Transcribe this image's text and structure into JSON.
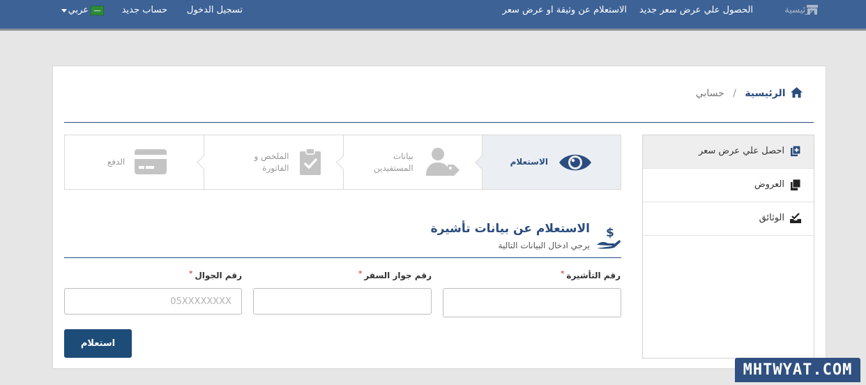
{
  "topbar": {
    "home": "الرئيسية",
    "get_quote": "الحصول علي عرض سعر جديد",
    "inquiry": "الاستعلام عن وثيقة او عرض سعر",
    "login": "تسجيل الدخول",
    "new_account": "حساب جديد",
    "language": "عربي"
  },
  "breadcrumb": {
    "home": "الرئيسية",
    "separator": "/",
    "current": "حسابي"
  },
  "sidebar": {
    "items": [
      {
        "label": "احصل علي عرض سعر",
        "icon": "add-copy-icon",
        "active": true
      },
      {
        "label": "العروض",
        "icon": "copy-icon",
        "active": false
      },
      {
        "label": "الوثائق",
        "icon": "inbox-check-icon",
        "active": false
      }
    ]
  },
  "steps": [
    {
      "label": "الاستعلام",
      "icon": "eye-icon",
      "active": true
    },
    {
      "label_line1": "بيانات",
      "label_line2": "المستفيدين",
      "icon": "user-tag-icon",
      "active": false
    },
    {
      "label_line1": "الملخص و",
      "label_line2": "الفاتورة",
      "icon": "clipboard-check-icon",
      "active": false
    },
    {
      "label": "الدفع",
      "icon": "credit-card-icon",
      "active": false
    }
  ],
  "section": {
    "title": "الاستعلام عن بيانات تأشيرة",
    "subtitle": "يرجي ادخال البيانات التالية",
    "icon": "hand-dollar-icon"
  },
  "form": {
    "visa_label": "رقم التأشيرة",
    "visa_value": "",
    "passport_label": "رقم جواز السفر",
    "passport_value": "",
    "mobile_label": "رقم الجوال",
    "mobile_placeholder": "05XXXXXXXX",
    "required_mark": "*",
    "submit": "استعلام"
  },
  "watermark": "MHTWYAT.COM",
  "colors": {
    "topbar": "#3c6296",
    "primary": "#2b4c7e",
    "button": "#1d4c78",
    "required": "#d9534f"
  }
}
